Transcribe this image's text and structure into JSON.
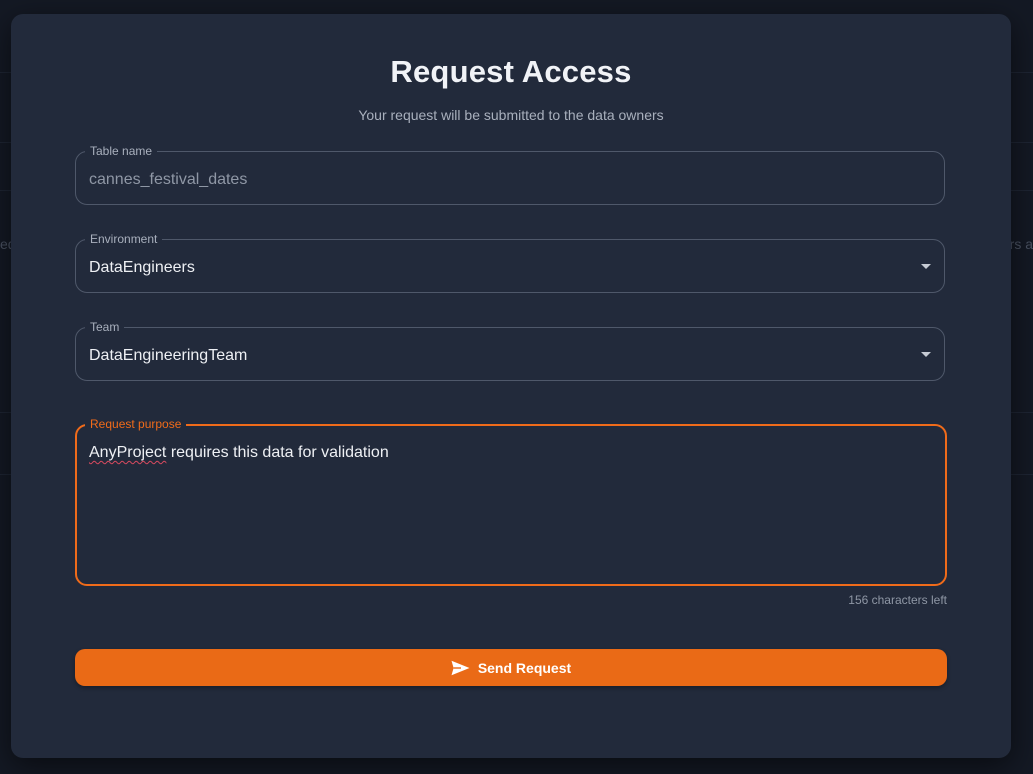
{
  "background": {
    "left_fragment": "ed",
    "right_fragment": "rs a"
  },
  "dialog": {
    "title": "Request Access",
    "subtitle": "Your request will be submitted to the data owners"
  },
  "fields": {
    "table_name": {
      "label": "Table name",
      "value": "cannes_festival_dates",
      "disabled": true
    },
    "environment": {
      "label": "Environment",
      "value": "DataEngineers"
    },
    "team": {
      "label": "Team",
      "value": "DataEngineeringTeam"
    },
    "purpose": {
      "label": "Request purpose",
      "value_misspelled": "AnyProject",
      "value_rest": " requires this data for validation",
      "helper": "156 characters left"
    }
  },
  "actions": {
    "send_label": "Send Request",
    "send_icon": "send-icon"
  },
  "colors": {
    "accent": "#ea6a16",
    "modal_bg": "#222a3b",
    "border": "#4f586a"
  }
}
